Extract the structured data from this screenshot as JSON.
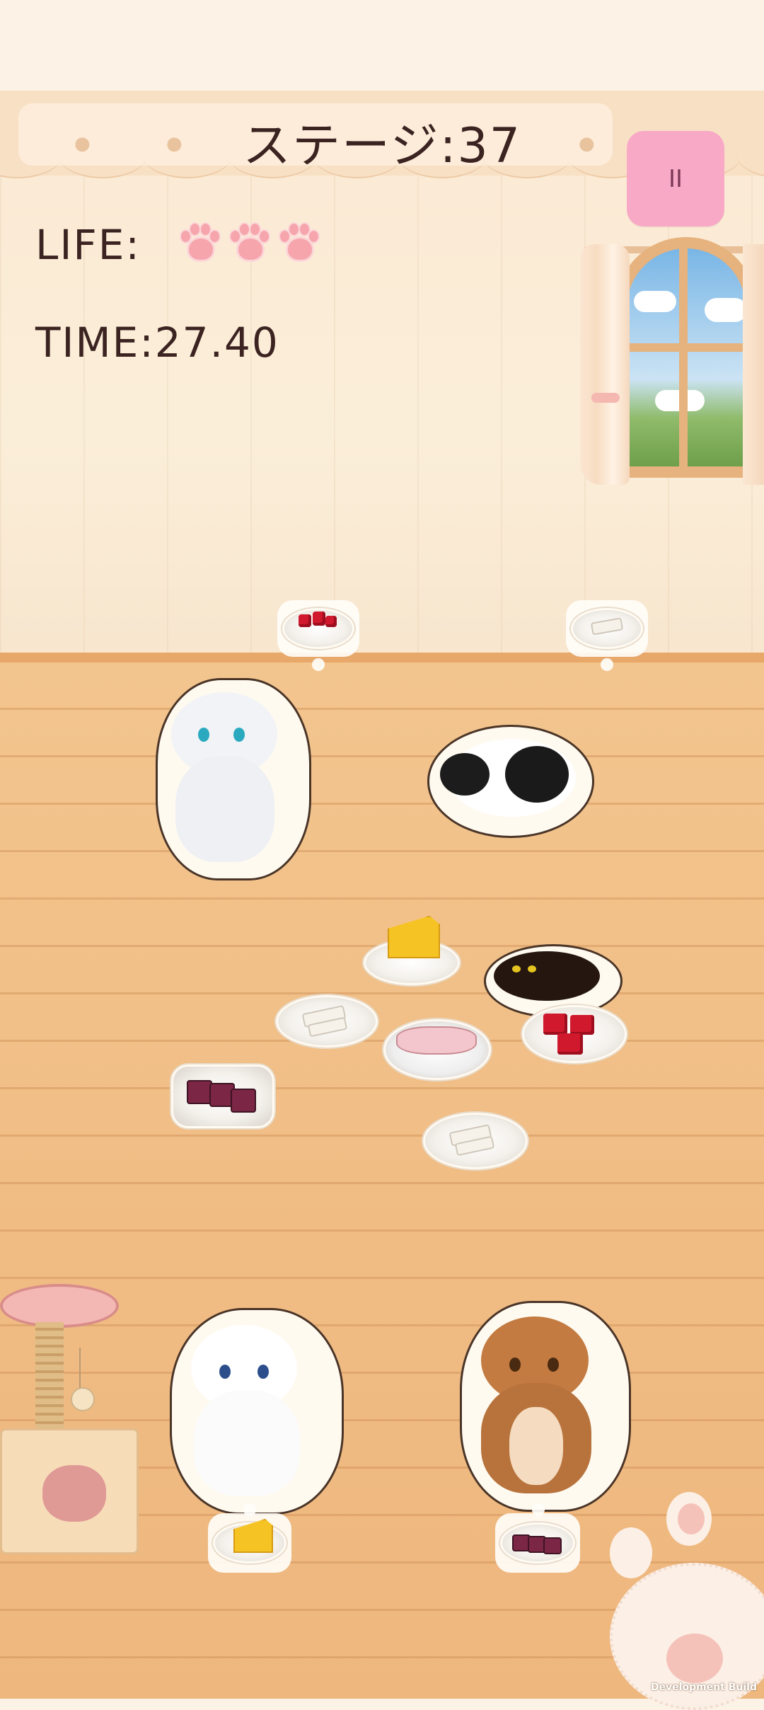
{
  "hud": {
    "stage_title": "ステージ:37",
    "pause_icon_text": "II",
    "life_label": "LIFE:",
    "life_count": 3,
    "time_label": "TIME:27.40"
  },
  "wants": {
    "top_left_cat": "meat",
    "top_right_cat": "fish",
    "bottom_left_cat": "cheese",
    "bottom_right_cat": "sushi"
  },
  "icons": [
    "pause-icon",
    "paw-icon",
    "meat-icon",
    "fish-icon",
    "cheese-icon",
    "sushi-icon",
    "ham-icon"
  ],
  "footer": {
    "dev_label": "Development Build"
  }
}
